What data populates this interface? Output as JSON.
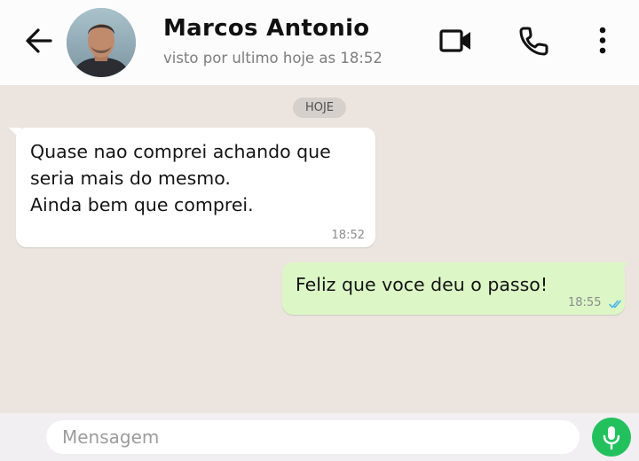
{
  "header": {
    "contact_name": "Marcos Antonio",
    "status": "visto por ultimo hoje as 18:52",
    "icons": {
      "back": "arrow-left-icon",
      "video": "video-camera-icon",
      "call": "phone-icon",
      "menu": "more-vertical-icon"
    }
  },
  "chat": {
    "date_label": "HOJE",
    "messages": [
      {
        "direction": "incoming",
        "text": "Quase nao comprei achando que\nseria mais do mesmo.\nAinda bem que comprei.",
        "time": "18:52"
      },
      {
        "direction": "outgoing",
        "text": "Feliz que voce deu o passo!",
        "time": "18:55",
        "status": "read"
      }
    ]
  },
  "composer": {
    "placeholder": "Mensagem",
    "value": "",
    "mic_icon": "microphone-icon"
  },
  "colors": {
    "chat_background": "#ece5df",
    "incoming_bubble": "#ffffff",
    "outgoing_bubble": "#dcf6c6",
    "mic_button": "#22c15e",
    "read_ticks": "#4fb6ec"
  }
}
